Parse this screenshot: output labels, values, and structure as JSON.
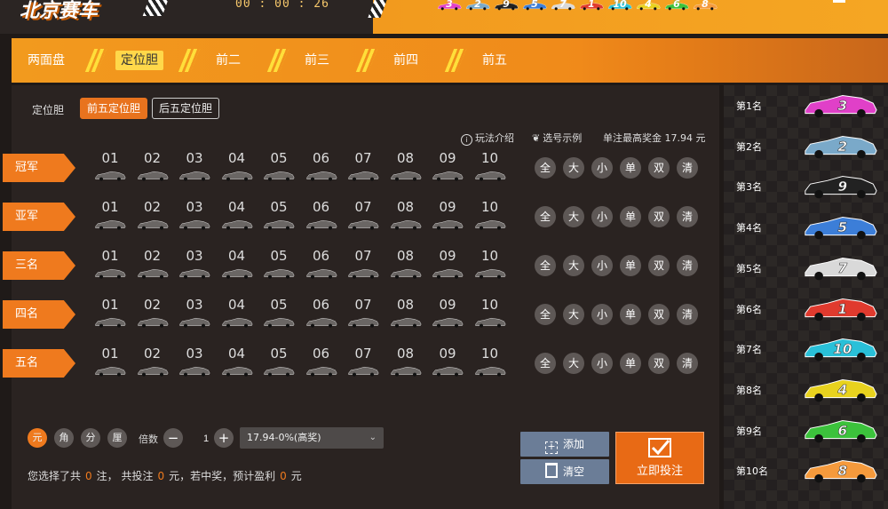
{
  "header": {
    "logo": "北京赛车",
    "timer": "00 : 00 : 26",
    "minicars": [
      {
        "num": "3",
        "color": "#e040c8"
      },
      {
        "num": "2",
        "color": "#7aa9c9"
      },
      {
        "num": "9",
        "color": "#222222"
      },
      {
        "num": "5",
        "color": "#3c7ed8"
      },
      {
        "num": "7",
        "color": "#d9d9d9"
      },
      {
        "num": "1",
        "color": "#e03a2e"
      },
      {
        "num": "10",
        "color": "#29c0d8"
      },
      {
        "num": "4",
        "color": "#e8d21e"
      },
      {
        "num": "6",
        "color": "#3cc23c"
      },
      {
        "num": "8",
        "color": "#f59a3c"
      }
    ]
  },
  "tabs": [
    "两面盘",
    "定位胆",
    "前二",
    "前三",
    "前四",
    "前五"
  ],
  "active_tab": "定位胆",
  "subtabs": {
    "label": "定位胆",
    "items": [
      "前五定位胆",
      "后五定位胆"
    ],
    "active": "前五定位胆"
  },
  "info": {
    "rules": "玩法介绍",
    "example": "选号示例",
    "max_prize": "单注最高奖金 17.94 元"
  },
  "rows": [
    {
      "label": "冠军"
    },
    {
      "label": "亚军"
    },
    {
      "label": "三名"
    },
    {
      "label": "四名"
    },
    {
      "label": "五名"
    }
  ],
  "balls": [
    "01",
    "02",
    "03",
    "04",
    "05",
    "06",
    "07",
    "08",
    "09",
    "10"
  ],
  "quick": [
    "全",
    "大",
    "小",
    "单",
    "双",
    "清"
  ],
  "units": [
    "元",
    "角",
    "分",
    "厘"
  ],
  "active_unit": "元",
  "multiplier": {
    "label": "倍数",
    "value": "1",
    "minus": "−",
    "plus": "+"
  },
  "odds": "17.94-0%(高奖)",
  "summary": {
    "p1": "您选择了共",
    "count": "0",
    "p2": "注，  共投注",
    "amount": "0",
    "p3": "元，若中奖，预计盈利",
    "profit": "0",
    "p4": "元"
  },
  "buttons": {
    "add": "添加",
    "clear": "清空",
    "bet": "立即投注"
  },
  "ranking": [
    {
      "label": "第1名",
      "num": "3",
      "color": "#e040c8"
    },
    {
      "label": "第2名",
      "num": "2",
      "color": "#7aa9c9"
    },
    {
      "label": "第3名",
      "num": "9",
      "color": "#222222"
    },
    {
      "label": "第4名",
      "num": "5",
      "color": "#3c7ed8"
    },
    {
      "label": "第5名",
      "num": "7",
      "color": "#d9d9d9"
    },
    {
      "label": "第6名",
      "num": "1",
      "color": "#e03a2e"
    },
    {
      "label": "第7名",
      "num": "10",
      "color": "#29c0d8"
    },
    {
      "label": "第8名",
      "num": "4",
      "color": "#e8d21e"
    },
    {
      "label": "第9名",
      "num": "6",
      "color": "#3cc23c"
    },
    {
      "label": "第10名",
      "num": "8",
      "color": "#f59a3c"
    }
  ]
}
